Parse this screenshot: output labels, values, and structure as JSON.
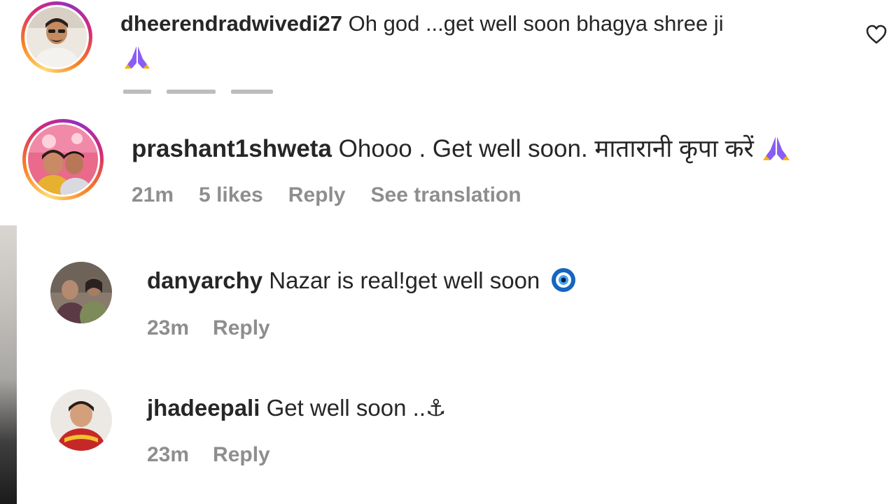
{
  "comments": [
    {
      "username": "dheerendradwivedi27",
      "text": "Oh god ...get well soon bhagya shree ji",
      "emoji": "pray-emoji"
    },
    {
      "username": "prashant1shweta",
      "text": "Ohooo . Get well soon. मातारानी कृपा करें",
      "emoji": "pray-emoji",
      "time": "21m",
      "likes": "5 likes",
      "reply_label": "Reply",
      "translation_label": "See translation"
    },
    {
      "username": "danyarchy",
      "text": "Nazar is real!get well soon",
      "emoji": "nazar-amulet-emoji",
      "time": "23m",
      "reply_label": "Reply"
    },
    {
      "username": "jhadeepali",
      "text": "Get well soon ..⚓",
      "time": "23m",
      "reply_label": "Reply"
    }
  ],
  "colors": {
    "text": "#262626",
    "meta": "#8e8e8e",
    "story_ring_start": "#feda75",
    "story_ring_end": "#962fbf",
    "nazar_blue": "#1565c0"
  }
}
